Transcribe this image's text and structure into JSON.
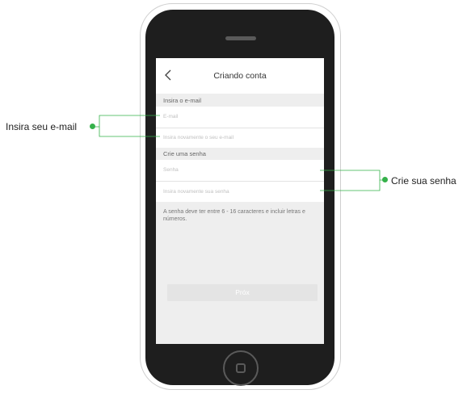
{
  "header": {
    "back_icon": "chevron-left-icon",
    "title": "Criando conta"
  },
  "email_section": {
    "label": "Insira o e-mail",
    "email_placeholder": "E-mail",
    "confirm_placeholder": "Insira novamente o seu e-mail"
  },
  "password_section": {
    "label": "Crie uma senha",
    "password_placeholder": "Senha",
    "confirm_placeholder": "Insira novamente sua senha"
  },
  "hint": "A senha deve ter entre 6 - 16 caracteres e incluir letras e números.",
  "next_button": "Próx",
  "callouts": {
    "email": "Insira seu e-mail",
    "password": "Crie sua senha"
  },
  "colors": {
    "accent": "#35b14a",
    "phone_body": "#1e1e1e",
    "screen_bg": "#eeeeee"
  }
}
